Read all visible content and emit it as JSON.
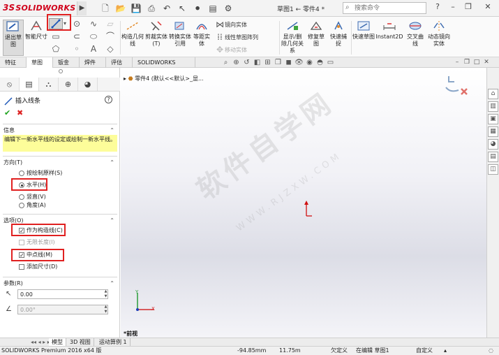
{
  "app": {
    "logo_prefix": "3S",
    "logo_text": "SOLIDWORKS",
    "document_title": "草图1 ← 零件4 *",
    "search_placeholder": "搜索命令"
  },
  "ribbon": {
    "exit_sketch": "退出草图",
    "smart_dimension": "智能尺寸",
    "trim_entities": "剪裁实体(T)",
    "convert_entities": "转换实体引用",
    "offset_entities": "等距实体",
    "mirror_entities": "镜向实体",
    "linear_pattern": "线性草图阵列",
    "move_entities": "移动实体",
    "show_delete_relations": "显示/删除几何关系",
    "repair_sketch": "修复草图",
    "quick_snaps": "快速捕捉",
    "rapid_sketch": "快速草图",
    "instant2d": "Instant2D",
    "intersection_curve": "交叉曲线",
    "dynamic_mirror": "动态镜向实体",
    "construction_geometry": "构造几何线"
  },
  "tabs": [
    {
      "label": "特征"
    },
    {
      "label": "草图"
    },
    {
      "label": "钣金"
    },
    {
      "label": "焊件"
    },
    {
      "label": "评估"
    },
    {
      "label": "SOLIDWORKS MBD"
    }
  ],
  "property_manager": {
    "title": "插入线条",
    "help": "?",
    "info_group": "信息",
    "info_text": "编辑下一新水平线的设定或绘制一新水平线。",
    "orientation_group": "方向(T)",
    "orientation_options": [
      {
        "label": "按绘制原样(S)",
        "checked": false
      },
      {
        "label": "水平(H)",
        "checked": true
      },
      {
        "label": "竖直(V)",
        "checked": false
      },
      {
        "label": "角度(A)",
        "checked": false
      }
    ],
    "options_group": "选项(O)",
    "options": [
      {
        "label": "作为构造线(C)",
        "checked": true,
        "enabled": true
      },
      {
        "label": "无限长度(I)",
        "checked": false,
        "enabled": false
      },
      {
        "label": "中点线(M)",
        "checked": true,
        "enabled": true
      },
      {
        "label": "添加尺寸(D)",
        "checked": false,
        "enabled": true
      }
    ],
    "parameters_group": "参数(R)",
    "length_value": "0.00",
    "angle_value": "0.00°"
  },
  "graphics": {
    "tree_crumb": "零件4 (默认<<默认>_显...",
    "view_label": "*前视",
    "watermark": "软件自学网",
    "watermark_sub": "WWW.RJZXW.COM",
    "axis_x": "X",
    "axis_y": "Y"
  },
  "bottom_tabs": [
    {
      "label": "模型"
    },
    {
      "label": "3D 视图"
    },
    {
      "label": "运动算例 1"
    }
  ],
  "status": {
    "product": "SOLIDWORKS Premium 2016 x64 版",
    "x_coord": "-94.85mm",
    "y_coord": "11.75m",
    "definition": "欠定义",
    "editing": "在编辑 草图1",
    "units": "自定义"
  },
  "colors": {
    "brand_red": "#d0021b",
    "highlight_box": "#e02020",
    "info_yellow": "#fdfd9a",
    "ok_green": "#1ea31e"
  }
}
